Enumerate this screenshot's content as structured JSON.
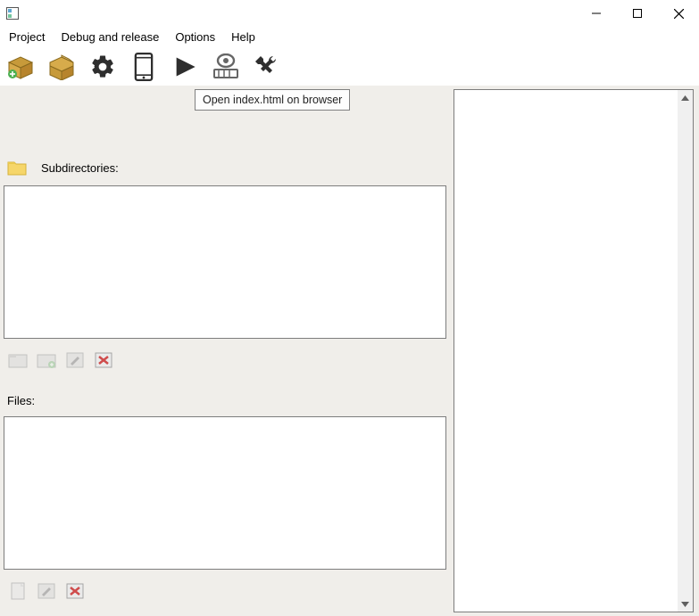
{
  "window": {
    "title": ""
  },
  "menu": {
    "items": [
      "Project",
      "Debug and release",
      "Options",
      "Help"
    ]
  },
  "tooltip": "Open index.html on browser",
  "labels": {
    "subdirs": "Subdirectories:",
    "files": "Files:"
  }
}
